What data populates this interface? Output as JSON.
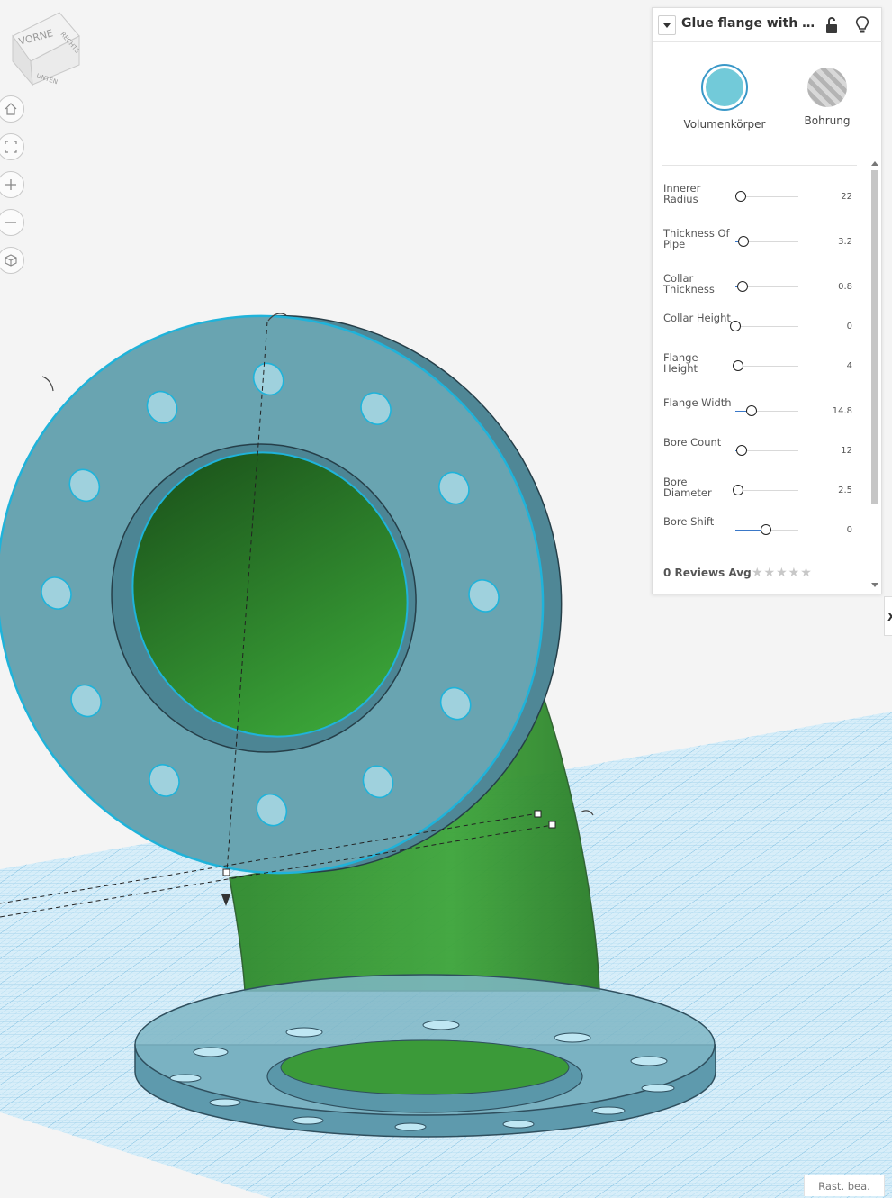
{
  "viewcube": {
    "front": "VORNE",
    "right": "RECHTS",
    "bottom": "UNTEN"
  },
  "nav_buttons": [
    {
      "icon": "home-icon"
    },
    {
      "icon": "fit-view-icon"
    },
    {
      "icon": "zoom-in-icon"
    },
    {
      "icon": "zoom-out-icon"
    },
    {
      "icon": "perspective-icon"
    }
  ],
  "inspector": {
    "title": "Glue flange with bo...",
    "modes": [
      {
        "label": "Volumenkörper",
        "color": "#72cad9"
      },
      {
        "label": "Bohrung"
      }
    ],
    "parameters": [
      {
        "name": "Innerer Radius",
        "value": "22",
        "level": 0.08
      },
      {
        "name": "Thickness Of Pipe",
        "value": "3.2",
        "level": 0.13
      },
      {
        "name": "Collar Thickness",
        "value": "0.8",
        "level": 0.12
      },
      {
        "name": "Collar Height",
        "value": "0",
        "level": 0.0
      },
      {
        "name": "Flange Height",
        "value": "4",
        "level": 0.04
      },
      {
        "name": "Flange Width",
        "value": "14.8",
        "level": 0.26
      },
      {
        "name": "Bore Count",
        "value": "12",
        "level": 0.1
      },
      {
        "name": "Bore Diameter",
        "value": "2.5",
        "level": 0.04
      },
      {
        "name": "Bore Shift",
        "value": "0",
        "level": 0.48
      }
    ],
    "reviews_label": "0 Reviews Avg",
    "stars": "★★★★★"
  },
  "side_tab": "X",
  "status": "Rast. bea."
}
